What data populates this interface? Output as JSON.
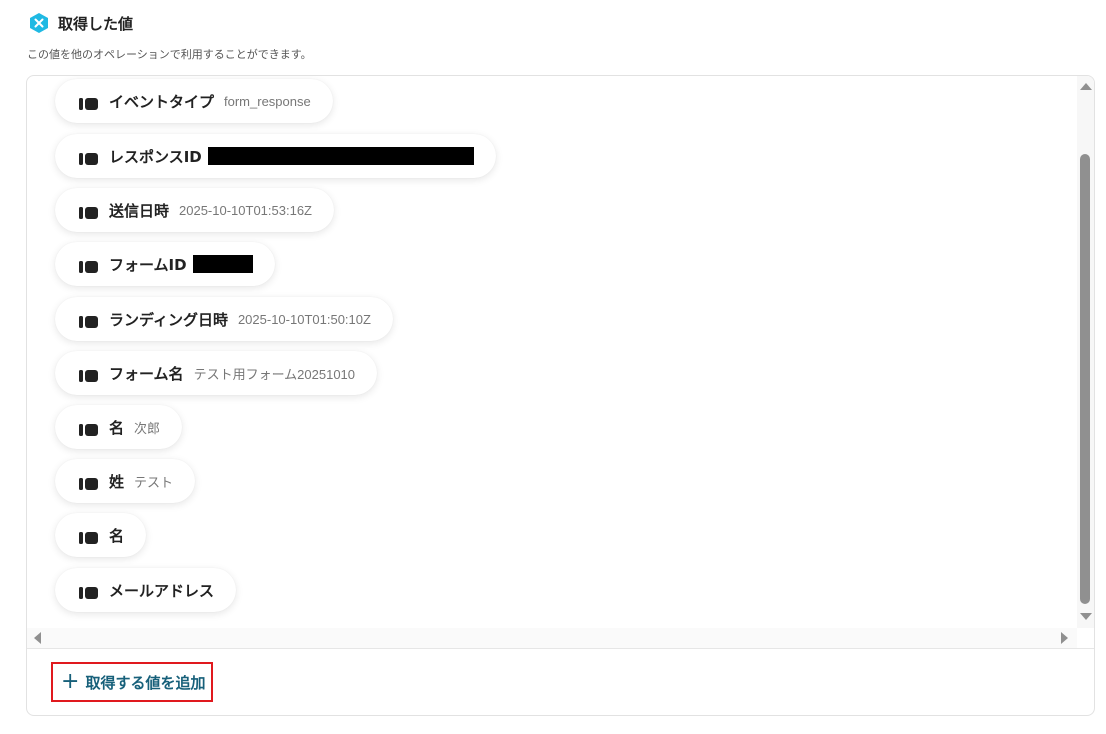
{
  "header": {
    "title": "取得した値",
    "subtitle": "この値を他のオペレーションで利用することができます。",
    "icon": "brand-logo-icon",
    "accent": "#1fb9e3"
  },
  "fields": [
    {
      "label": "イベントタイプ",
      "value": "form_response"
    },
    {
      "label": "レスポンスID",
      "value": "",
      "redacted": true
    },
    {
      "label": "送信日時",
      "value": "2025-10-10T01:53:16Z"
    },
    {
      "label": "フォームID",
      "value": "",
      "redacted": true
    },
    {
      "label": "ランディング日時",
      "value": "2025-10-10T01:50:10Z"
    },
    {
      "label": "フォーム名",
      "value": "テスト用フォーム20251010"
    },
    {
      "label": "名",
      "value": "次郎"
    },
    {
      "label": "姓",
      "value": "テスト"
    },
    {
      "label": "名",
      "value": ""
    },
    {
      "label": "メールアドレス",
      "value": ""
    }
  ],
  "actions": {
    "add_label": "取得する値を追加",
    "add_icon": "plus-icon",
    "add_border_color": "#e0191e",
    "text_color": "#17607a"
  }
}
